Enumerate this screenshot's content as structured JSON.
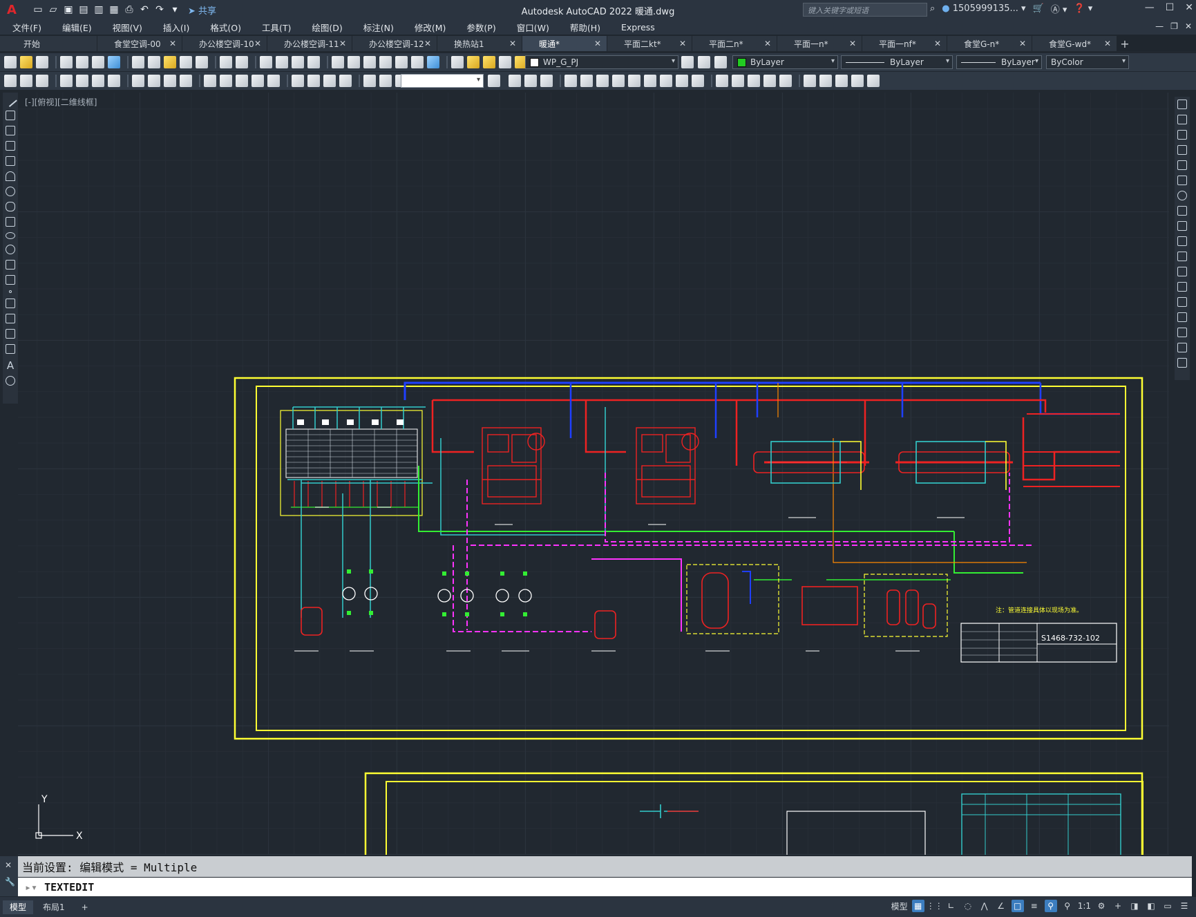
{
  "app": {
    "title": "Autodesk AutoCAD 2022    暖通.dwg",
    "logo": "A",
    "share_label": "共享",
    "search_placeholder": "键入关键字或短语",
    "user": "1505999135...",
    "accent_color": "#e0262b"
  },
  "menu": [
    "文件(F)",
    "编辑(E)",
    "视图(V)",
    "插入(I)",
    "格式(O)",
    "工具(T)",
    "绘图(D)",
    "标注(N)",
    "修改(M)",
    "参数(P)",
    "窗口(W)",
    "帮助(H)",
    "Express"
  ],
  "tabs": [
    {
      "label": "开始",
      "active": false,
      "closable": false
    },
    {
      "label": "食堂空调-00",
      "active": false,
      "closable": true
    },
    {
      "label": "办公楼空调-10",
      "active": false,
      "closable": true
    },
    {
      "label": "办公楼空调-11",
      "active": false,
      "closable": true
    },
    {
      "label": "办公楼空调-12",
      "active": false,
      "closable": true
    },
    {
      "label": "换热站1",
      "active": false,
      "closable": true
    },
    {
      "label": "暖通*",
      "active": true,
      "closable": true
    },
    {
      "label": "平面二kt*",
      "active": false,
      "closable": true
    },
    {
      "label": "平面二n*",
      "active": false,
      "closable": true
    },
    {
      "label": "平面一n*",
      "active": false,
      "closable": true
    },
    {
      "label": "平面一nf*",
      "active": false,
      "closable": true
    },
    {
      "label": "食堂G-n*",
      "active": false,
      "closable": true
    },
    {
      "label": "食堂G-wd*",
      "active": false,
      "closable": true
    }
  ],
  "properties": {
    "layer": "WP_G_PJ",
    "color": "ByLayer",
    "color_swatch": "#22cc22",
    "linetype": "ByLayer",
    "lineweight": "ByLayer",
    "plotstyle": "ByColor"
  },
  "viewport_label": "[-][俯视][二维线框]",
  "drawing": {
    "sheet_number": "S1468-732-102",
    "note": "注：管道连接具体以现场为准。"
  },
  "command": {
    "history": "当前设置: 编辑模式 = Multiple",
    "input": "TEXTEDIT"
  },
  "layout_tabs": [
    "模型",
    "布局1"
  ],
  "status": {
    "model_label": "模型",
    "scale": "1:1"
  }
}
